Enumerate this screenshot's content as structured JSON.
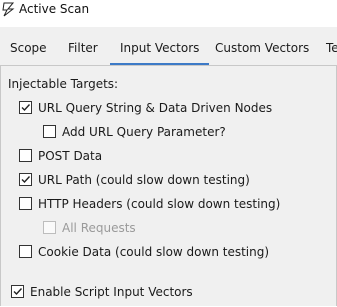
{
  "window": {
    "title": "Active Scan"
  },
  "tabs": [
    {
      "label": "Scope",
      "active": false
    },
    {
      "label": "Filter",
      "active": false
    },
    {
      "label": "Input Vectors",
      "active": true
    },
    {
      "label": "Custom Vectors",
      "active": false
    },
    {
      "label": "Te",
      "active": false
    }
  ],
  "panel": {
    "section_label": "Injectable Targets:",
    "options": {
      "url_query": {
        "label": "URL Query String & Data Driven Nodes",
        "checked": true,
        "enabled": true
      },
      "add_url_param": {
        "label": "Add URL Query Parameter?",
        "checked": false,
        "enabled": true
      },
      "post_data": {
        "label": "POST Data",
        "checked": false,
        "enabled": true
      },
      "url_path": {
        "label": "URL Path (could slow down testing)",
        "checked": true,
        "enabled": true
      },
      "http_headers": {
        "label": "HTTP Headers (could slow down testing)",
        "checked": false,
        "enabled": true
      },
      "all_requests": {
        "label": "All Requests",
        "checked": false,
        "enabled": false
      },
      "cookie_data": {
        "label": "Cookie Data (could slow down testing)",
        "checked": false,
        "enabled": true
      },
      "script_vectors": {
        "label": "Enable Script Input Vectors",
        "checked": true,
        "enabled": true
      }
    }
  },
  "colors": {
    "accent": "#3d7ac7",
    "panel_bg": "#f0f0f0"
  },
  "icons": {
    "app": "zap-bolt-icon",
    "check": "check-mark-icon"
  }
}
